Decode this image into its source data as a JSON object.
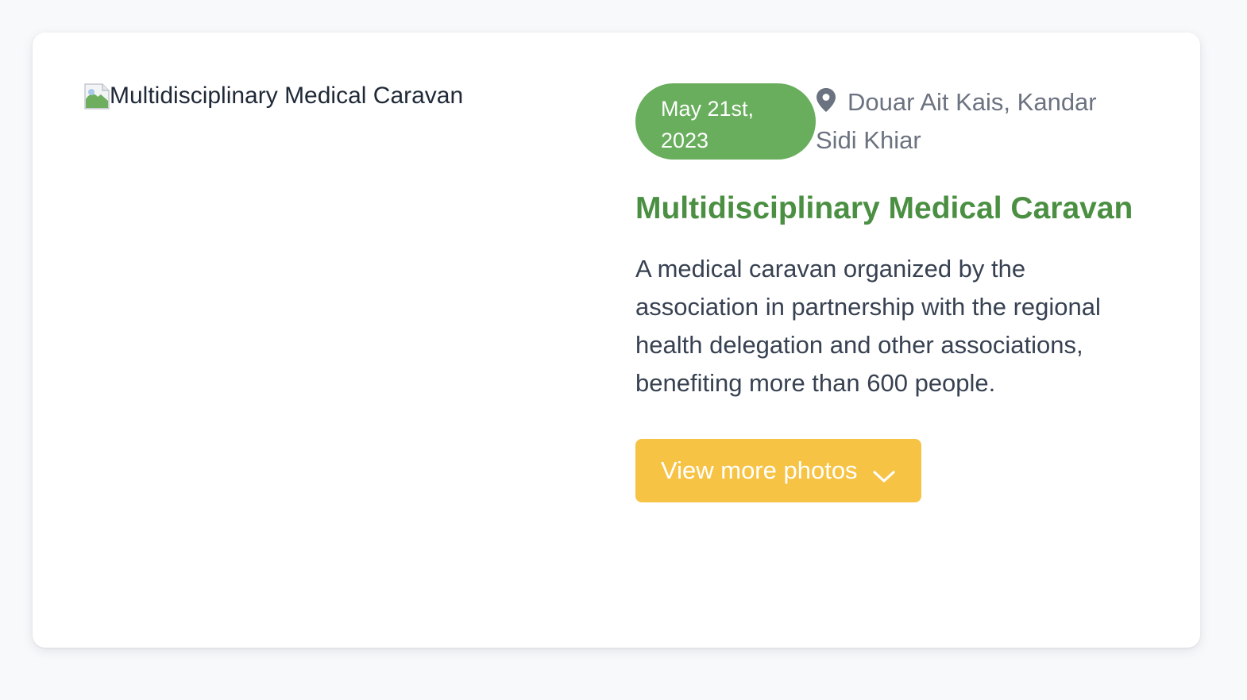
{
  "event": {
    "image_alt": "Multidisciplinary Medical Caravan",
    "date": "May 21st, 2023",
    "location": "Douar Ait Kais, Kandar Sidi Khiar",
    "title": "Multidisciplinary Medical Caravan",
    "description": "A medical caravan organized by the association in partnership with the regional health delegation and other associations, benefiting more than 600 people.",
    "button_label": "View more photos"
  },
  "icons": {
    "image": "broken-image-icon",
    "location": "map-pin-icon",
    "button": "chevron-down-icon"
  },
  "colors": {
    "accent_green": "#68ae5c",
    "title_green": "#4a8f42",
    "button_yellow": "#f6c344",
    "muted_text": "#6b7280"
  }
}
